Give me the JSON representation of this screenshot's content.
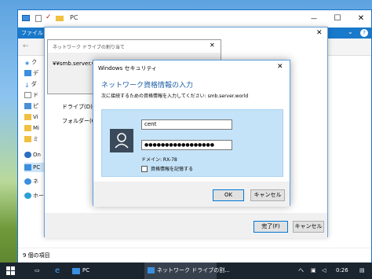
{
  "explorer": {
    "title": "PC",
    "ribbon_file": "ファイル",
    "sidebar_items": [
      "ク",
      "デ",
      "ダ",
      "ド",
      "ピ",
      "Vi",
      "Mi",
      "ミ",
      "On",
      "PC",
      "ネ",
      "ホー"
    ],
    "status": "9 個の項目",
    "minimize": "—",
    "maximize": "☐",
    "close": "✕",
    "chevron": "⌄",
    "help": "?"
  },
  "map_drive": {
    "title": "ネットワーク ドライブの割り当て",
    "drive_label": "ドライブ(D):",
    "folder_label": "フォルダー(O):",
    "finish_button": "完了(F)",
    "cancel_button": "キャンセル",
    "close": "✕"
  },
  "behind_window": {
    "title": "ネットワーク ドライブの割り当て",
    "path": "¥¥smb.server.wo",
    "close": "✕"
  },
  "security": {
    "title": "Windows セキュリティ",
    "heading": "ネットワーク資格情報の入力",
    "subtitle": "次に接続するための資格情報を入力してください: smb.server.world",
    "username": "cent",
    "password": "●●●●●●●●●●●●●●●●●",
    "domain": "ドメイン: RX-78",
    "remember": "資格情報を記憶する",
    "ok": "OK",
    "cancel": "キャンセル",
    "close": "✕"
  },
  "taskbar": {
    "pc_label": "PC",
    "active_label": "ネットワーク ドライブの割...",
    "time": "0:26",
    "tray_text": "へ"
  },
  "colors": {
    "accent": "#1979ca",
    "cred_bg": "#c5e3f8",
    "heading": "#1d5fa6"
  }
}
